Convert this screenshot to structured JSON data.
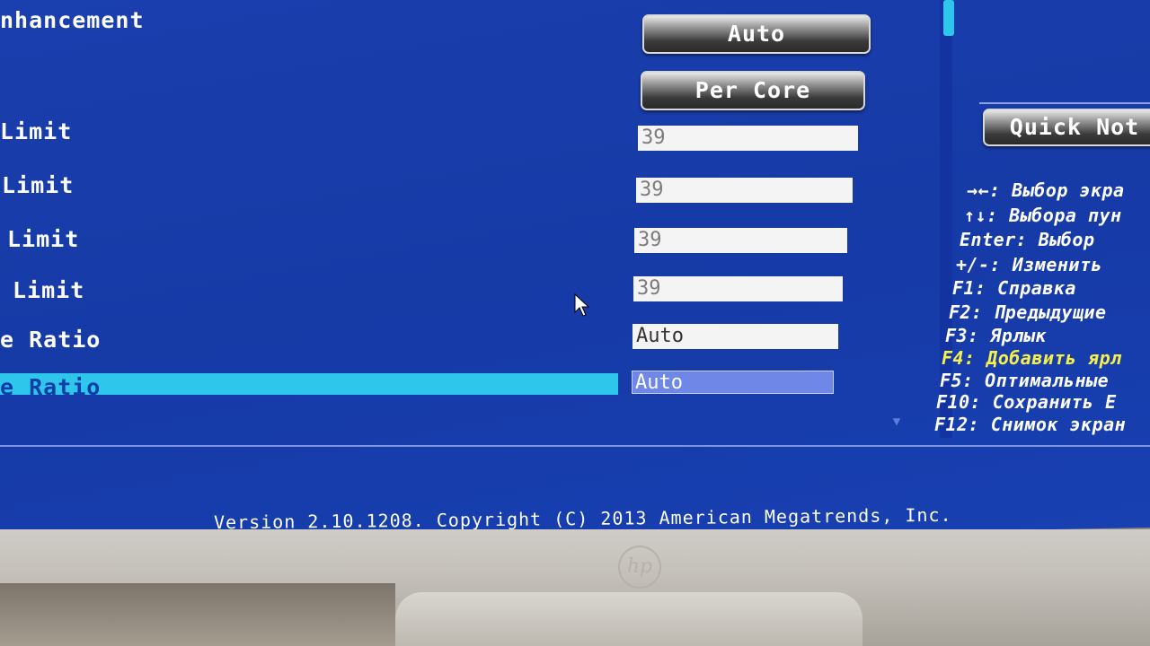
{
  "settings": [
    {
      "label": "nhancement",
      "type": "button",
      "value": "Auto"
    },
    {
      "label": "",
      "type": "button",
      "value": "Per Core"
    },
    {
      "label": "Limit",
      "type": "field",
      "value": "39"
    },
    {
      "label": "Limit",
      "type": "field",
      "value": "39"
    },
    {
      "label": "Limit",
      "type": "field",
      "value": "39"
    },
    {
      "label": "Limit",
      "type": "field",
      "value": "39"
    },
    {
      "label": "e Ratio",
      "type": "field",
      "value": "Auto"
    },
    {
      "label": "e Ratio",
      "type": "field",
      "value": "Auto",
      "selected": true
    }
  ],
  "quick_note_button": "Quick Not",
  "help": [
    "→←: Выбор экра",
    "↑↓: Выбора пун",
    "Enter: Выбор",
    "+/-: Изменить ",
    "F1: Справка",
    "F2: Предыдущие",
    "F3: Ярлык",
    "F4: Добавить ярл",
    "F5: Оптимальные",
    "F10: Сохранить Е",
    "F12: Снимок экран"
  ],
  "version_text": "Version 2.10.1208. Copyright (C) 2013 American Megatrends, Inc.",
  "brand_logo": "hp",
  "colors": {
    "screen_bg": "#163aa6",
    "selection": "#2fc6ec",
    "highlight_help": "#f6f04a"
  }
}
